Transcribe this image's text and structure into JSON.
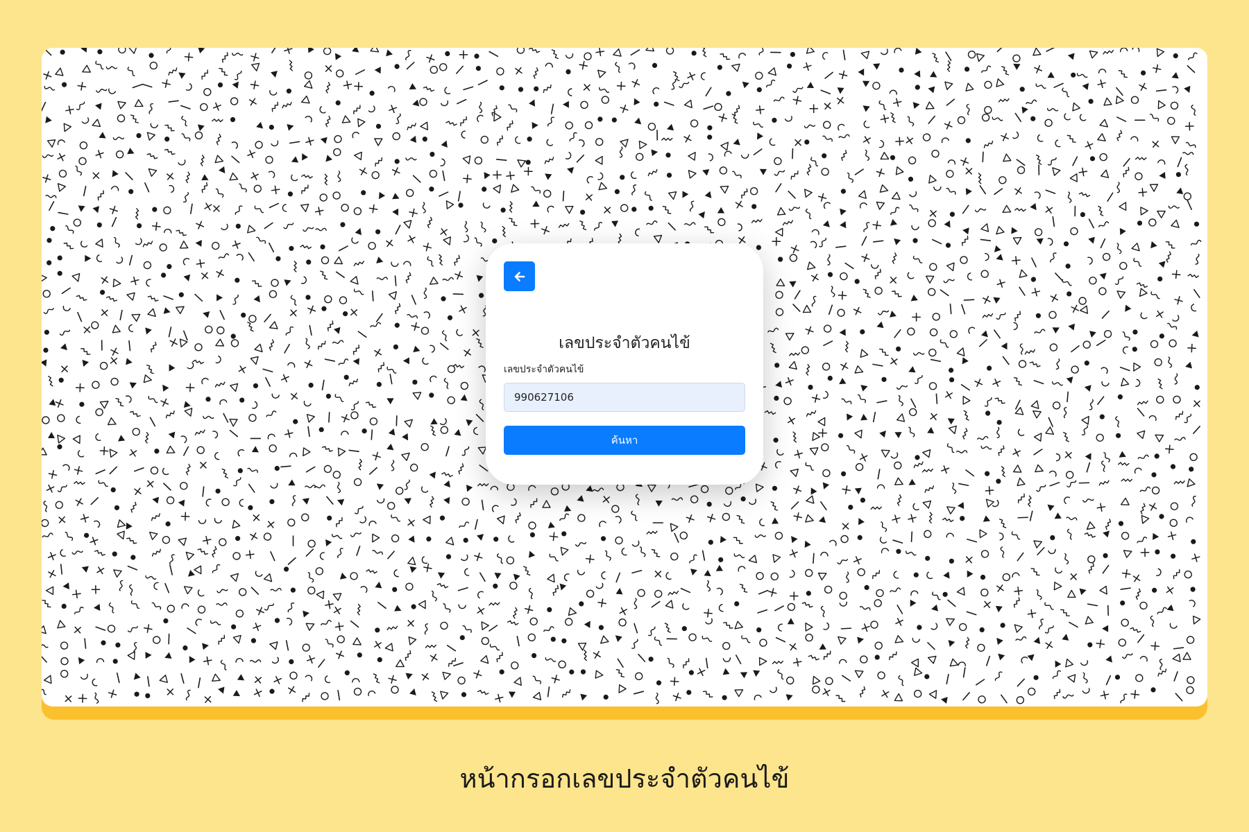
{
  "colors": {
    "page_background": "#FDE58D",
    "frame_accent": "#FBC02D",
    "primary": "#0A7CFF",
    "input_background": "#E8F0FE",
    "pattern_ink": "#1a1a1a"
  },
  "icons": {
    "back": "arrow-left-icon",
    "background": "memphis-pattern"
  },
  "card": {
    "title": "เลขประจำตัวคนไข้",
    "field_label": "เลขประจำตัวคนไข้",
    "id_value": "990627106",
    "search_label": "ค้นหา"
  },
  "caption": "หน้ากรอกเลขประจำตัวคนไข้"
}
